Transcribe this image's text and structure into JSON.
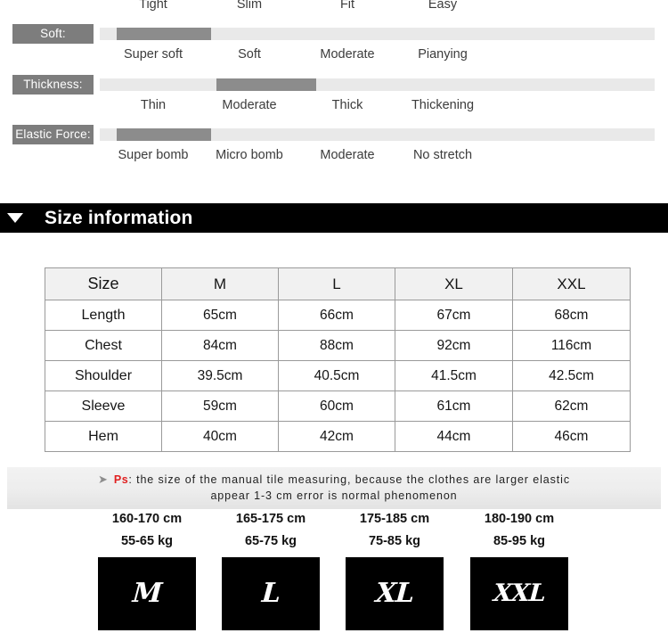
{
  "attributes": {
    "rows": [
      {
        "label": "",
        "marker_left_pct": 0,
        "marker_width_pct": 0,
        "ticks": [
          "Tight",
          "Slim",
          "Fit",
          "Easy"
        ]
      },
      {
        "label": "Soft:",
        "marker_left_pct": 3,
        "marker_width_pct": 17,
        "ticks": [
          "Super soft",
          "Soft",
          "Moderate",
          "Pianying"
        ]
      },
      {
        "label": "Thickness:",
        "marker_left_pct": 21,
        "marker_width_pct": 18,
        "ticks": [
          "Thin",
          "Moderate",
          "Thick",
          "Thickening"
        ]
      },
      {
        "label": "Elastic Force:",
        "marker_left_pct": 3,
        "marker_width_pct": 17,
        "ticks": [
          "Super bomb",
          "Micro bomb",
          "Moderate",
          "No stretch"
        ]
      }
    ]
  },
  "size_information": {
    "banner_title": "Size information",
    "caret_icon": "triangle-down-icon",
    "table": {
      "headers": [
        "Size",
        "M",
        "L",
        "XL",
        "XXL"
      ],
      "rows": [
        {
          "label": "Length",
          "values": [
            "65cm",
            "66cm",
            "67cm",
            "68cm"
          ]
        },
        {
          "label": "Chest",
          "values": [
            "84cm",
            "88cm",
            "92cm",
            "116cm"
          ]
        },
        {
          "label": "Shoulder",
          "values": [
            "39.5cm",
            "40.5cm",
            "41.5cm",
            "42.5cm"
          ]
        },
        {
          "label": "Sleeve",
          "values": [
            "59cm",
            "60cm",
            "61cm",
            "62cm"
          ]
        },
        {
          "label": "Hem",
          "values": [
            "40cm",
            "42cm",
            "44cm",
            "46cm"
          ]
        }
      ]
    }
  },
  "ps_note": {
    "arrow_icon": "➤",
    "tag": "Ps",
    "line1": ": the size of the manual tile measuring, because the clothes are larger elastic",
    "line2": "appear 1-3 cm error is normal phenomenon"
  },
  "size_cards": [
    {
      "height": "160-170 cm",
      "weight": "55-65 kg",
      "badge": "M"
    },
    {
      "height": "165-175 cm",
      "weight": "65-75 kg",
      "badge": "L"
    },
    {
      "height": "175-185 cm",
      "weight": "75-85 kg",
      "badge": "XL"
    },
    {
      "height": "180-190 cm",
      "weight": "85-95 kg",
      "badge": "XXL"
    }
  ],
  "colors": {
    "label_bg": "#7d7d7d",
    "track_bg": "#e9e9e9",
    "marker_bg": "#8c8c8c",
    "banner_bg": "#000000",
    "ps_tag": "#e02020",
    "table_border": "#9a9a9a",
    "table_header_bg": "#f1f1f1"
  }
}
